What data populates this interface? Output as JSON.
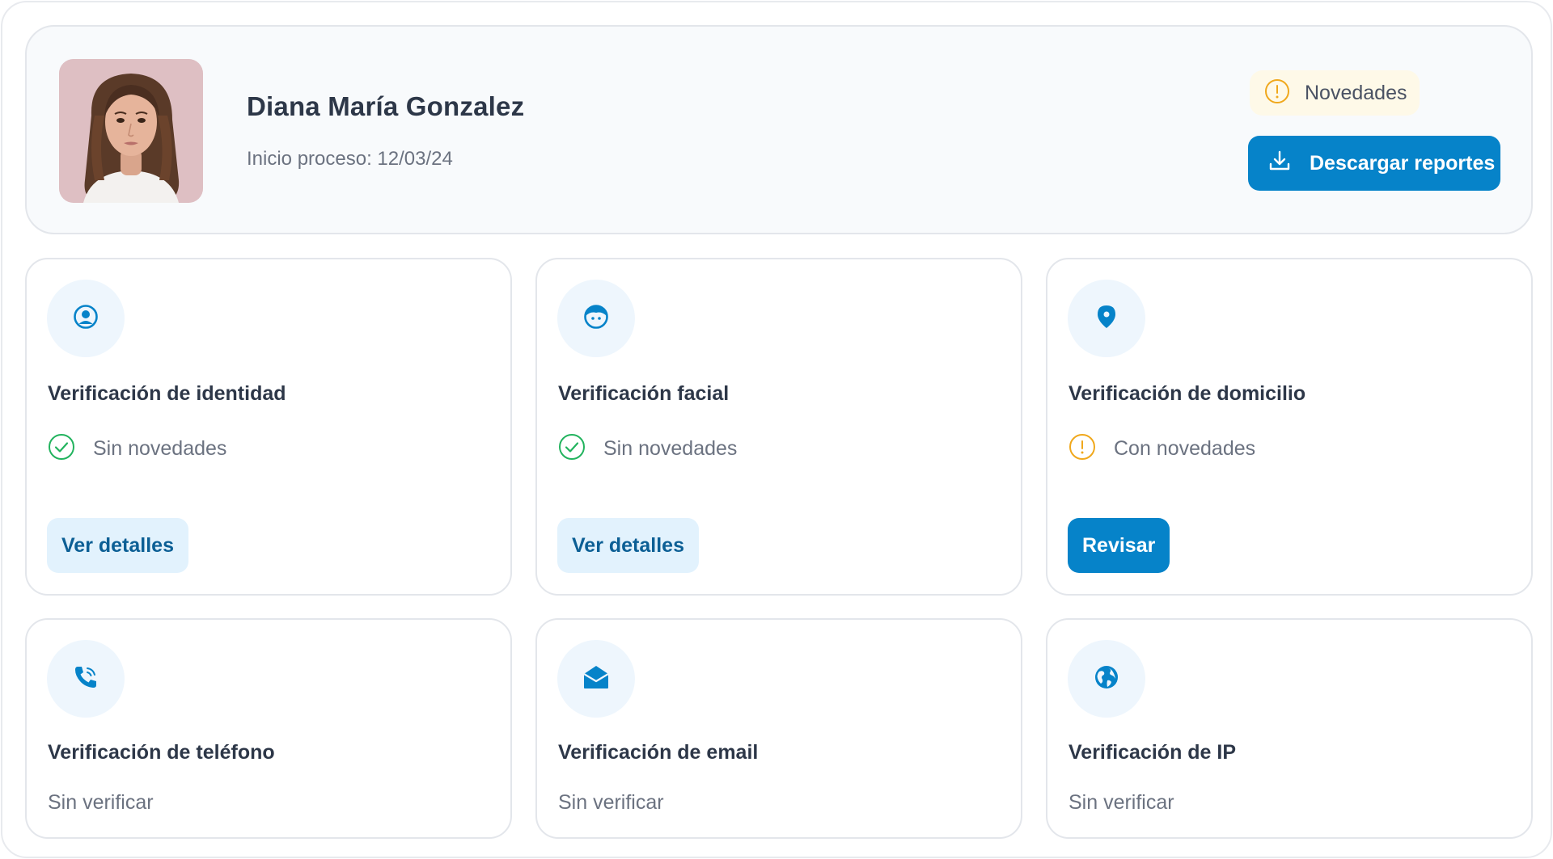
{
  "profile": {
    "name": "Diana María Gonzalez",
    "subtitle": "Inicio proceso: 12/03/24",
    "badge": {
      "label": "Novedades",
      "icon": "warning-circle-icon"
    },
    "download_button": {
      "label": "Descargar reportes",
      "icon": "download-icon"
    }
  },
  "cards": [
    {
      "title": "Verificación de identidad",
      "icon": "user-circle-icon",
      "status": "Sin novedades",
      "status_kind": "ok",
      "action": "Ver detalles"
    },
    {
      "title": "Verificación facial",
      "icon": "face-icon",
      "status": "Sin novedades",
      "status_kind": "ok",
      "action": "Ver detalles"
    },
    {
      "title": "Verificación de domicilio",
      "icon": "location-pin-icon",
      "status": "Con novedades",
      "status_kind": "warning",
      "action": "Revisar"
    },
    {
      "title": "Verificación de teléfono",
      "icon": "phone-icon",
      "status": "Sin verificar",
      "status_kind": "pending"
    },
    {
      "title": "Verificación de email",
      "icon": "envelope-icon",
      "status": "Sin verificar",
      "status_kind": "pending"
    },
    {
      "title": "Verificación de IP",
      "icon": "globe-icon",
      "status": "Sin verificar",
      "status_kind": "pending"
    }
  ],
  "colors": {
    "primary": "#0683c9",
    "success": "#22b35e",
    "warning": "#f0a81c",
    "icon_bg": "#eef6fd"
  }
}
